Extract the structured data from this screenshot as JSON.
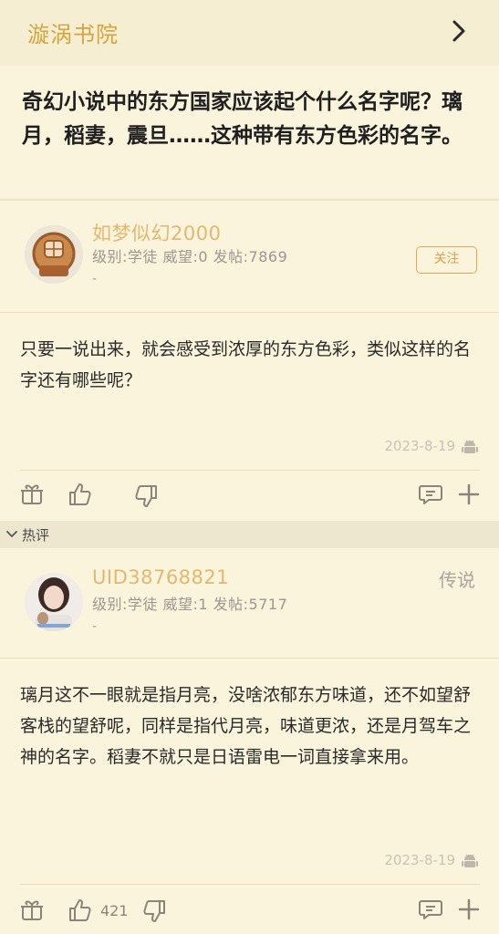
{
  "header": {
    "title": "漩涡书院"
  },
  "thread": {
    "title": "奇幻小说中的东方国家应该起个什么名字呢？璃月，稻妻，震旦……这种带有东方色彩的名字。"
  },
  "post": {
    "username": "如梦似幻2000",
    "meta": "级别:学徒 威望:0 发帖:7869",
    "signature": "-",
    "follow_label": "关注",
    "body": "只要一说出来，就会感受到浓厚的东方色彩，类似这样的名字还有哪些呢？",
    "date": "2023-8-19"
  },
  "hot_section": {
    "label": "热评"
  },
  "reply": {
    "username": "UID38768821",
    "rank": "传说",
    "meta": "级别:学徒 威望:1 发帖:5717",
    "signature": "-",
    "body": "璃月这不一眼就是指月亮，没啥浓郁东方味道，还不如望舒客栈的望舒呢，同样是指代月亮，味道更浓，还是月驾车之神的名字。稻妻不就只是日语雷电一词直接拿来用。",
    "date": "2023-8-19",
    "like_count": "421"
  },
  "icons": {
    "next": "chevron-right-icon",
    "device": "android-icon",
    "gift": "gift-icon",
    "like": "thumbs-up-icon",
    "dislike": "thumbs-down-icon",
    "comment": "comment-icon",
    "more": "plus-icon",
    "collapse": "chevron-down-icon"
  },
  "colors": {
    "background": "#fbf4dc",
    "accent": "#d4a53a",
    "username": "#e2b870"
  }
}
